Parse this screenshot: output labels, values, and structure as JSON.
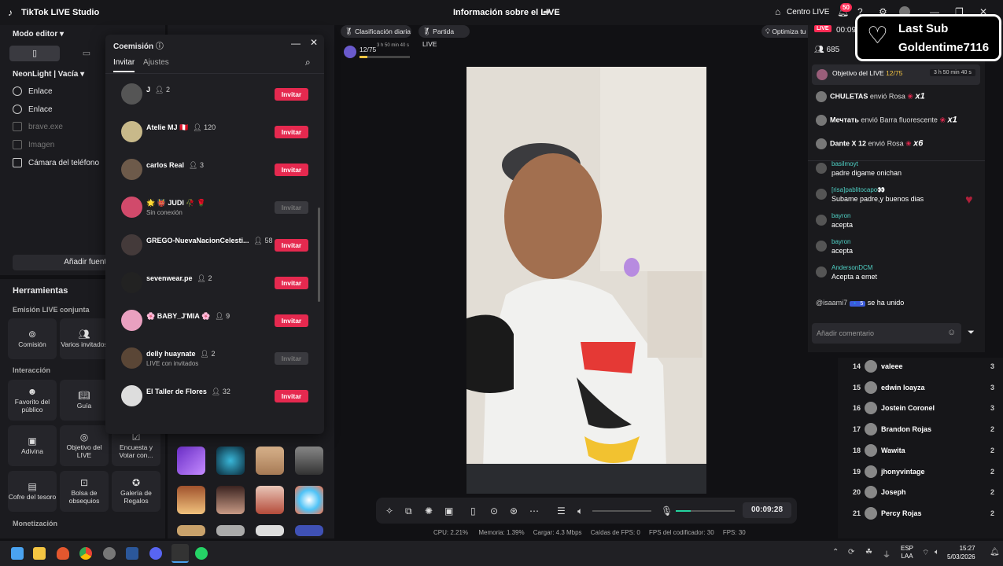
{
  "titlebar": {
    "app_title": "TikTok LIVE Studio",
    "center_title": "Información sobre el LIVE",
    "centro_live": "Centro LIVE",
    "notif_count": "50"
  },
  "left": {
    "mode": "Modo editor",
    "scene": "NeonLight | Vacía",
    "sources": [
      {
        "label": "Enlace",
        "disabled": false
      },
      {
        "label": "Enlace",
        "disabled": false
      },
      {
        "label": "brave.exe",
        "disabled": true
      },
      {
        "label": "Imagen",
        "disabled": true
      },
      {
        "label": "Cámara del teléfono",
        "disabled": false
      }
    ],
    "add_source": "Añadir fuente",
    "tools_title": "Herramientas",
    "section_joint": "Emisión LIVE conjunta",
    "tile_comision": "Comisión",
    "tile_varios": "Varios invitados",
    "section_interaccion": "Interacción",
    "tile_favorito": "Favorito del público",
    "tile_guia": "Guía",
    "tile_adivina": "Adivina",
    "tile_objetivo": "Objetivo del LIVE",
    "tile_encuesta": "Encuesta y Votar con...",
    "tile_cofre": "Cofre del tesoro",
    "tile_bolsa": "Bolsa de obsequios",
    "tile_galeria": "Galería de Regalos",
    "section_monet": "Monetización"
  },
  "modal": {
    "title": "Coemisión",
    "tab_invitar": "Invitar",
    "tab_ajustes": "Ajustes",
    "invite_label": "Invitar",
    "rows": [
      {
        "name": "J",
        "count": "2",
        "status": "",
        "enabled": true
      },
      {
        "name": "Atelie MJ 🇵🇪",
        "count": "120",
        "status": "",
        "enabled": true
      },
      {
        "name": "carlos Real",
        "count": "3",
        "status": "",
        "enabled": true
      },
      {
        "name": "🌟 👹 JUDI 🥀 🌹",
        "count": "",
        "status": "Sin conexión",
        "enabled": false
      },
      {
        "name": "GREGO-NuevaNacionCelesti...",
        "count": "58",
        "status": "",
        "enabled": true
      },
      {
        "name": "sevenwear.pe",
        "count": "2",
        "status": "",
        "enabled": true
      },
      {
        "name": "🌸 BABY_J'MIA 🌸",
        "count": "9",
        "status": "",
        "enabled": true
      },
      {
        "name": "delly huaynate",
        "count": "2",
        "status": "LIVE con invitados",
        "enabled": false
      },
      {
        "name": "El Taller de Flores",
        "count": "32",
        "status": "",
        "enabled": true
      }
    ]
  },
  "stream": {
    "clasificacion": "Clasificación diaria",
    "partida": "Partida LIVE",
    "optimiza": "Optimiza tu",
    "goal_progress": "12/75",
    "goal_time": "3 h 50 min 40 s",
    "goal_fraction": 0.16
  },
  "controls": {
    "timer": "00:09:28",
    "volume_level": 0.25
  },
  "stats": {
    "cpu": "CPU:  2.21%",
    "mem": "Memoria:  1.39%",
    "cargar": "Cargar:  4.3 Mbps",
    "caidas": "Caídas de FPS:  0",
    "fps_cod": "FPS del codificador:  30",
    "fps": "FPS:  30"
  },
  "chat": {
    "live_badge": "LIVE",
    "timer": "00:09",
    "viewers": "685",
    "last_sub_title": "Last Sub",
    "last_sub_user": "Goldentime7116",
    "objetivo": "Objetivo del LIVE",
    "objetivo_progress": "12/75",
    "objetivo_time": "3 h 50 min 40 s",
    "gifts": [
      {
        "user": "CHULETAS",
        "text": "envió Rosa",
        "mult": "x1"
      },
      {
        "user": "Мечтать",
        "text": "envió Barra fluorescente",
        "mult": "x1"
      },
      {
        "user": "Dante X 12",
        "text": "envió Rosa",
        "mult": "x6"
      }
    ],
    "messages": [
      {
        "user": "basilmoyt",
        "text": "padre digame onichan"
      },
      {
        "user": "[risa]pablitocapo👀",
        "text": "Subame padre,y buenos dias"
      },
      {
        "user": "bayron",
        "text": "acepta"
      },
      {
        "user": "bayron",
        "text": "acepta"
      },
      {
        "user": "AndersonDCM",
        "text": "Acepta a emet"
      }
    ],
    "joined_user": "@isaami7",
    "joined_text": "se ha unido",
    "comment_placeholder": "Añadir comentario"
  },
  "ranking": [
    {
      "pos": "14",
      "name": "valeee",
      "score": "3"
    },
    {
      "pos": "15",
      "name": "edwin loayza",
      "score": "3"
    },
    {
      "pos": "16",
      "name": "Jostein Coronel",
      "score": "3"
    },
    {
      "pos": "17",
      "name": "Brandon Rojas",
      "score": "2"
    },
    {
      "pos": "18",
      "name": "Wawita",
      "score": "2"
    },
    {
      "pos": "19",
      "name": "jhonyvintage",
      "score": "2"
    },
    {
      "pos": "20",
      "name": "Joseph",
      "score": "2"
    },
    {
      "pos": "21",
      "name": "Percy Rojas",
      "score": "2"
    }
  ],
  "taskbar": {
    "lang": "ESP",
    "lang2": "LAA",
    "time": "15:27",
    "date": "5/03/2026"
  },
  "colors": {
    "accent": "#fe2c55",
    "invite_btn": "#e5294f",
    "chat_user": "#4fd1c5"
  }
}
